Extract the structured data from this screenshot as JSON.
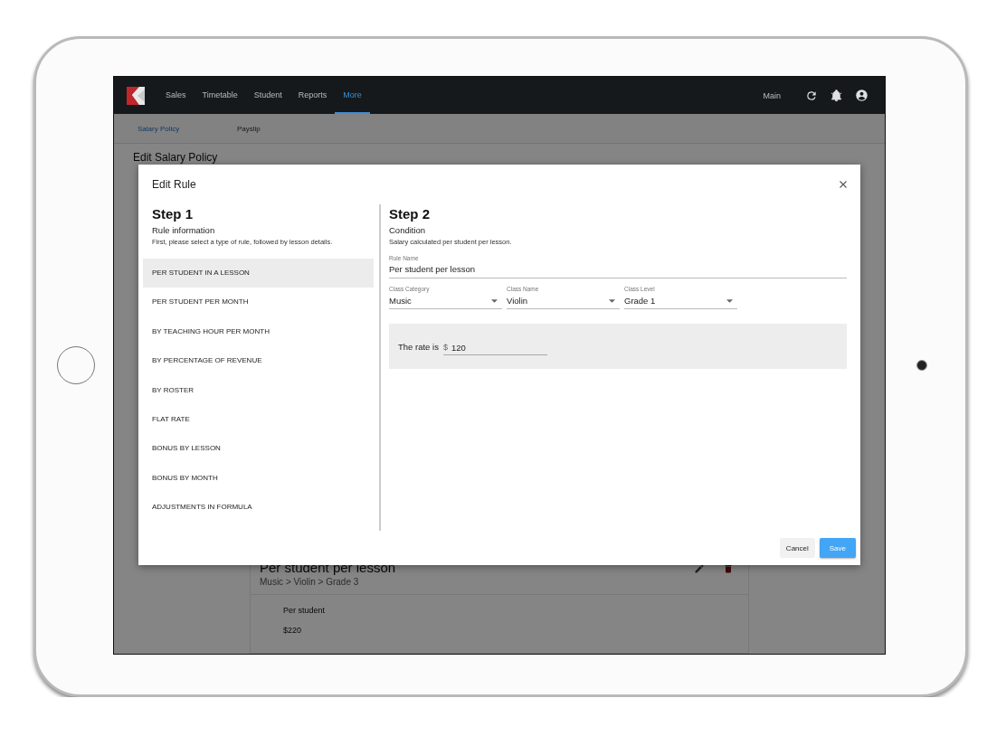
{
  "navbar": {
    "menu": [
      {
        "label": "Sales",
        "selected": false
      },
      {
        "label": "Timetable",
        "selected": false
      },
      {
        "label": "Student",
        "selected": false
      },
      {
        "label": "Reports",
        "selected": false
      },
      {
        "label": "More",
        "selected": true
      }
    ],
    "workspace": "Main"
  },
  "subtabs": [
    {
      "label": "Salary Policy",
      "selected": true
    },
    {
      "label": "Payslip",
      "selected": false
    }
  ],
  "page_title": "Edit Salary Policy",
  "rule_card": {
    "title": "Per student per lesson",
    "path": "Music > Violin > Grade 3",
    "label": "Per student",
    "amount": "$220"
  },
  "dialog": {
    "title": "Edit Rule",
    "step1": {
      "heading": "Step 1",
      "subtitle": "Rule information",
      "hint": "First, please select a type of rule, followed by lesson details.",
      "rule_types": [
        {
          "label": "PER STUDENT IN A LESSON",
          "selected": true
        },
        {
          "label": "PER STUDENT PER MONTH",
          "selected": false
        },
        {
          "label": "BY TEACHING HOUR PER MONTH",
          "selected": false
        },
        {
          "label": "BY PERCENTAGE OF REVENUE",
          "selected": false
        },
        {
          "label": "BY ROSTER",
          "selected": false
        },
        {
          "label": "FLAT RATE",
          "selected": false
        },
        {
          "label": "BONUS BY LESSON",
          "selected": false
        },
        {
          "label": "BONUS BY MONTH",
          "selected": false
        },
        {
          "label": "ADJUSTMENTS IN FORMULA",
          "selected": false
        }
      ]
    },
    "step2": {
      "heading": "Step 2",
      "subtitle": "Condition",
      "description": "Salary calculated per student per lesson.",
      "rule_name": {
        "label": "Rule Name",
        "value": "Per student per lesson"
      },
      "selects": [
        {
          "label": "Class Category",
          "value": "Music"
        },
        {
          "label": "Class Name",
          "value": "Violin"
        },
        {
          "label": "Class Level",
          "value": "Grade 1"
        }
      ],
      "rate": {
        "label": "The rate is",
        "currency": "$",
        "value": "120"
      }
    },
    "buttons": [
      {
        "label": "Cancel",
        "kind": "secondary"
      },
      {
        "label": "Save",
        "kind": "primary"
      }
    ]
  }
}
